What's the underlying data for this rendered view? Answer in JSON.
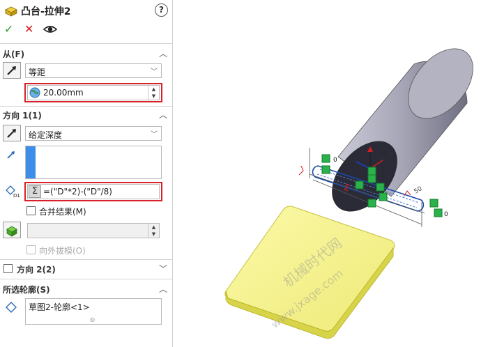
{
  "panel": {
    "title": "凸台-拉伸2",
    "help": "?",
    "actions": {
      "ok": "✓",
      "cancel": "✕"
    },
    "from": {
      "header": "从(F)",
      "type": "等距",
      "offset": "20.00mm"
    },
    "direction1": {
      "header": "方向 1(1)",
      "end_condition": "给定深度",
      "depth_equation": "=(\"D\"*2)-(\"D\"/8)",
      "merge_result": "合并结果(M)",
      "draft_outward": "向外拔模(O)"
    },
    "direction2": {
      "header": "方向 2(2)"
    },
    "selected_contours": {
      "header": "所选轮廓(S)",
      "items": [
        "草图2-轮廓<1>"
      ]
    }
  },
  "viewport": {
    "watermark_cn": "机械时代网",
    "watermark_url": "www.jxage.com",
    "dimension_labels": [
      "50",
      "0",
      "0",
      "0"
    ]
  },
  "colors": {
    "accent_red": "#d9202a",
    "list_blue": "#3c8ee8",
    "preview_yellow": "#f2ef8a",
    "cylinder_gray": "#9a9aa8"
  }
}
